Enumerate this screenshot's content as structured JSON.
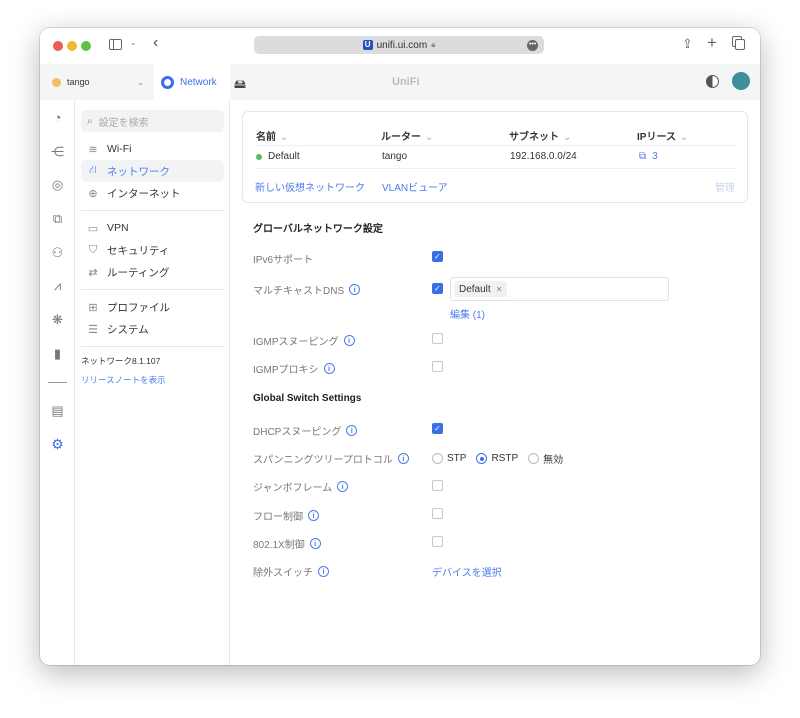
{
  "browser": {
    "url": "unifi.ui.com",
    "favicon": "U"
  },
  "tabbar": {
    "site": "tango",
    "app": "Network",
    "brand": "UniFi"
  },
  "rail": {
    "icons": [
      "dashboard-icon",
      "topology-icon",
      "devices-icon",
      "clients-icon",
      "users-icon",
      "insights-icon",
      "integrations-icon",
      "statistics-icon",
      "logs-icon",
      "settings-icon"
    ]
  },
  "sidebar": {
    "search_placeholder": "設定を検索",
    "items": [
      {
        "label": "Wi-Fi"
      },
      {
        "label": "ネットワーク"
      },
      {
        "label": "インターネット"
      },
      {
        "label": "VPN"
      },
      {
        "label": "セキュリティ"
      },
      {
        "label": "ルーティング"
      },
      {
        "label": "プロファイル"
      },
      {
        "label": "システム"
      }
    ],
    "version": "ネットワーク8.1.107",
    "release_notes": "リリースノートを表示"
  },
  "networks": {
    "columns": [
      "名前",
      "ルーター",
      "サブネット",
      "IPリース"
    ],
    "rows": [
      {
        "name": "Default",
        "router": "tango",
        "subnet": "192.168.0.0/24",
        "leases": "3",
        "status_color": "#5cb85c"
      }
    ],
    "new_network": "新しい仮想ネットワーク",
    "vlan_viewer": "VLANビューア",
    "manage": "管理"
  },
  "global": {
    "title": "グローバルネットワーク設定",
    "ipv6": {
      "label": "IPv6サポート",
      "checked": true
    },
    "mdns": {
      "label": "マルチキャストDNS",
      "checked": true,
      "tag": "Default",
      "edit": "編集 (1)"
    },
    "igmp_snooping": {
      "label": "IGMPスヌーピング",
      "checked": false
    },
    "igmp_proxy": {
      "label": "IGMPプロキシ",
      "checked": false
    }
  },
  "switch": {
    "title": "Global Switch Settings",
    "dhcp_snooping": {
      "label": "DHCPスヌーピング",
      "checked": true
    },
    "stp": {
      "label": "スパンニングツリープロトコル",
      "options": [
        "STP",
        "RSTP",
        "無効"
      ],
      "selected": "RSTP"
    },
    "jumbo": {
      "label": "ジャンボフレーム",
      "checked": false
    },
    "flow": {
      "label": "フロー制御",
      "checked": false
    },
    "dot1x": {
      "label": "802.1X制御",
      "checked": false
    },
    "exclude": {
      "label": "除外スイッチ",
      "action": "デバイスを選択"
    }
  },
  "colors": {
    "accent": "#3b6ee8",
    "link": "#4b7bec"
  }
}
